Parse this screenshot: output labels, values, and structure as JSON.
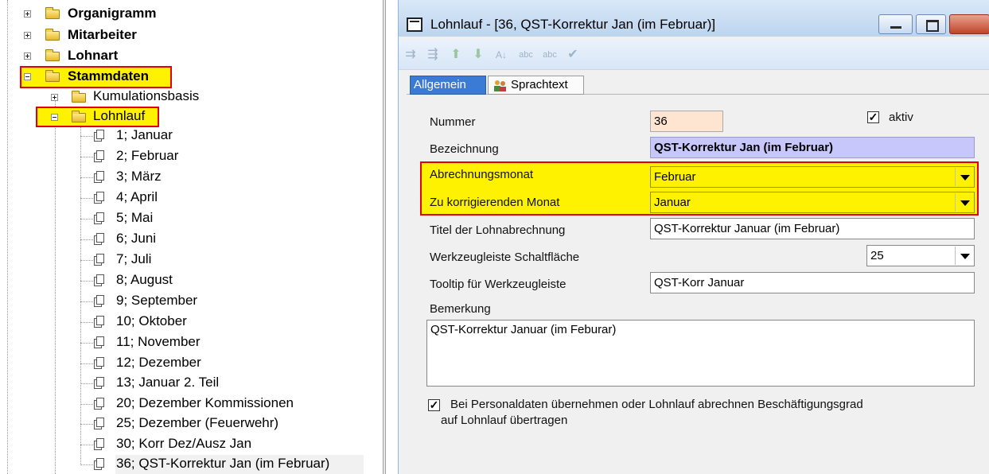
{
  "tree": {
    "top_nodes": [
      {
        "label": "Organigramm",
        "expander": "plus",
        "icon": "folder-icon"
      },
      {
        "label": "Mitarbeiter",
        "expander": "plus",
        "icon": "folder-icon"
      },
      {
        "label": "Lohnart",
        "expander": "plus",
        "icon": "folder-icon"
      },
      {
        "label": "Stammdaten",
        "expander": "minus",
        "icon": "folder-icon",
        "highlighted": true
      }
    ],
    "sub_nodes": [
      {
        "label": "Kumulationsbasis",
        "expander": "plus",
        "icon": "folder-icon"
      },
      {
        "label": "Lohnlauf",
        "expander": "minus",
        "icon": "folder-icon",
        "highlighted": true
      }
    ],
    "lohnlauf_items": [
      "1; Januar",
      "2; Februar",
      "3; März",
      "4; April",
      "5; Mai",
      "6; Juni",
      "7; Juli",
      "8; August",
      "9; September",
      "10; Oktober",
      "11; November",
      "12; Dezember",
      "13; Januar 2. Teil",
      "20; Dezember Kommissionen",
      "25; Dezember (Feuerwehr)",
      "30; Korr Dez/Ausz Jan",
      "36; QST-Korrektur Jan (im Februar)"
    ],
    "selected_item": "36; QST-Korrektur Jan (im Februar)"
  },
  "window": {
    "title": "Lohnlauf - [36, QST-Korrektur Jan (im Februar)]",
    "toolbar_icons": [
      "insert-row-icon",
      "delete-row-icon",
      "move-up-icon",
      "move-down-icon",
      "sort-az-icon",
      "spellcheck-icon",
      "spellcheck-save-icon",
      "clear-icon"
    ]
  },
  "tabs": [
    {
      "label": "Allgemein",
      "active": true
    },
    {
      "label": "Sprachtext",
      "active": false,
      "icon": "people-icon"
    }
  ],
  "form": {
    "nummer_label": "Nummer",
    "nummer_value": "36",
    "aktiv_label": "aktiv",
    "aktiv_checked": true,
    "bezeichnung_label": "Bezeichnung",
    "bezeichnung_value": "QST-Korrektur Jan (im Februar)",
    "abrechnungsmonat_label": "Abrechnungsmonat",
    "abrechnungsmonat_value": "Februar",
    "korrektur_monat_label": "Zu korrigierenden Monat",
    "korrektur_monat_value": "Januar",
    "titel_label": "Titel der Lohnabrechnung",
    "titel_value": "QST-Korrektur Januar (im Februar)",
    "schaltflaeche_label": "Werkzeugleiste Schaltfläche",
    "schaltflaeche_value": "25",
    "tooltip_label": "Tooltip für Werkzeugleiste",
    "tooltip_value": "QST-Korr Januar",
    "bemerkung_label": "Bemerkung",
    "bemerkung_value": "QST-Korrektur Januar (im Feburar)",
    "personaldaten_checked": true,
    "personaldaten_line1": "Bei Personaldaten übernehmen oder Lohnlauf abrechnen Beschäftigungsgrad",
    "personaldaten_line2": "auf Lohnlauf übertragen"
  },
  "colors": {
    "highlight_fill": "#fff200",
    "highlight_border": "#e40000",
    "active_tab": "#3b7bd5",
    "bezeichnung_bg": "#c7c7fb",
    "nummer_bg": "#fde5d2"
  }
}
